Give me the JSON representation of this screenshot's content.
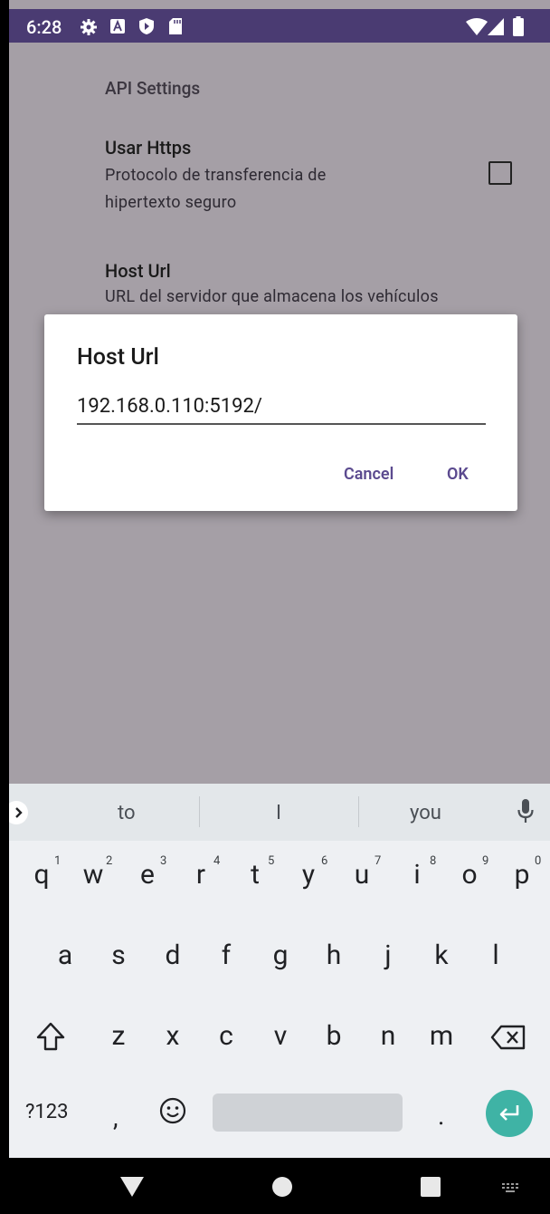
{
  "status_bar": {
    "time": "6:28"
  },
  "settings": {
    "category": "API Settings",
    "https": {
      "title": "Usar Https",
      "summary": "Protocolo de transferencia de hipertexto seguro",
      "checked": false
    },
    "host": {
      "title": "Host Url",
      "summary": "URL del servidor que almacena los vehículos"
    }
  },
  "dialog": {
    "title": "Host Url",
    "input_value": "192.168.0.110:5192/",
    "cancel_label": "Cancel",
    "ok_label": "OK"
  },
  "keyboard": {
    "suggestions": [
      "to",
      "I",
      "you"
    ],
    "row1": [
      "q",
      "w",
      "e",
      "r",
      "t",
      "y",
      "u",
      "i",
      "o",
      "p"
    ],
    "row1_hints": [
      "1",
      "2",
      "3",
      "4",
      "5",
      "6",
      "7",
      "8",
      "9",
      "0"
    ],
    "row2": [
      "a",
      "s",
      "d",
      "f",
      "g",
      "h",
      "j",
      "k",
      "l"
    ],
    "row3": [
      "z",
      "x",
      "c",
      "v",
      "b",
      "n",
      "m"
    ],
    "symbols_label": "?123",
    "comma": ",",
    "period": "."
  },
  "colors": {
    "accent": "#5b4a8f",
    "status_bar": "#4a3b72",
    "enter_key": "#3fb3a5",
    "scrim": "#a59fa6"
  }
}
